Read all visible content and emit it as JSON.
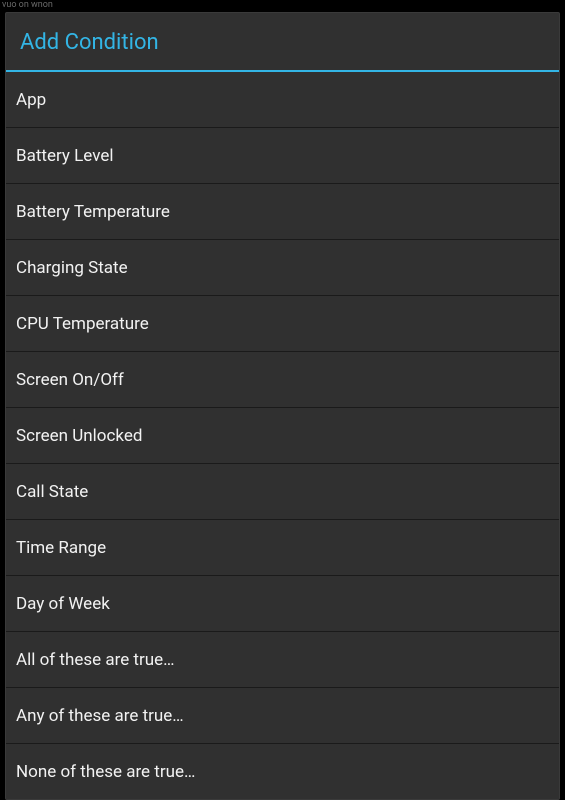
{
  "statusbar": {
    "text": "vuo on wnon"
  },
  "dialog": {
    "title": "Add Condition",
    "items": [
      "App",
      "Battery Level",
      "Battery Temperature",
      "Charging State",
      "CPU Temperature",
      "Screen On/Off",
      "Screen Unlocked",
      "Call State",
      "Time Range",
      "Day of Week",
      "All of these are true…",
      "Any of these are true…",
      "None of these are true…"
    ]
  }
}
